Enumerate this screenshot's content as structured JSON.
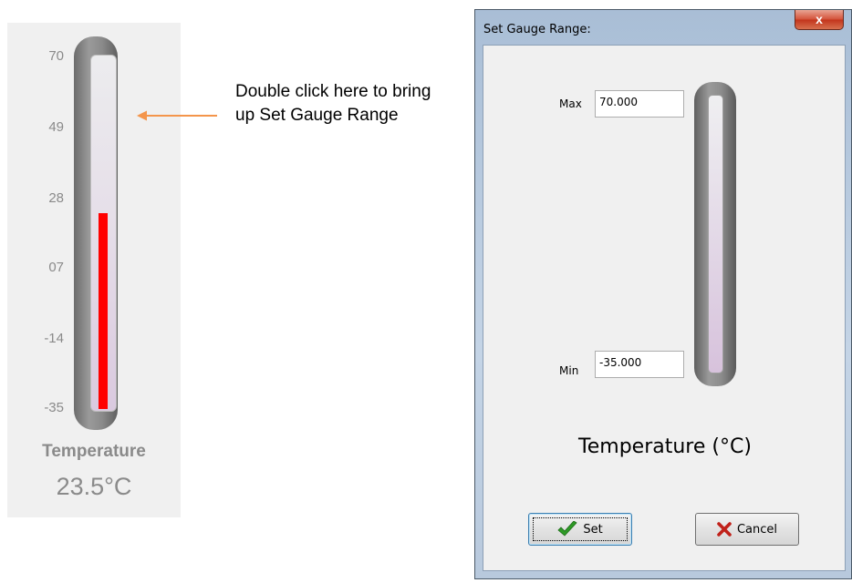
{
  "gauge": {
    "ticks": [
      "70",
      "49",
      "28",
      "07",
      "-14",
      "-35"
    ],
    "title": "Temperature",
    "value_text": "23.5°C",
    "range_min": -35,
    "range_max": 70,
    "current_value": 23.5,
    "fill_color": "#ff0000"
  },
  "annotation": {
    "text": "Double click here to bring up Set Gauge Range",
    "arrow_color": "#f4954b"
  },
  "dialog": {
    "title": "Set Gauge Range:",
    "close_glyph": "x",
    "max_label": "Max",
    "max_value": "70.000",
    "min_label": "Min",
    "min_value": "-35.000",
    "gauge_title": "Temperature (°C)",
    "set_label": "Set",
    "cancel_label": "Cancel",
    "set_icon": "check-icon",
    "cancel_icon": "x-icon"
  }
}
